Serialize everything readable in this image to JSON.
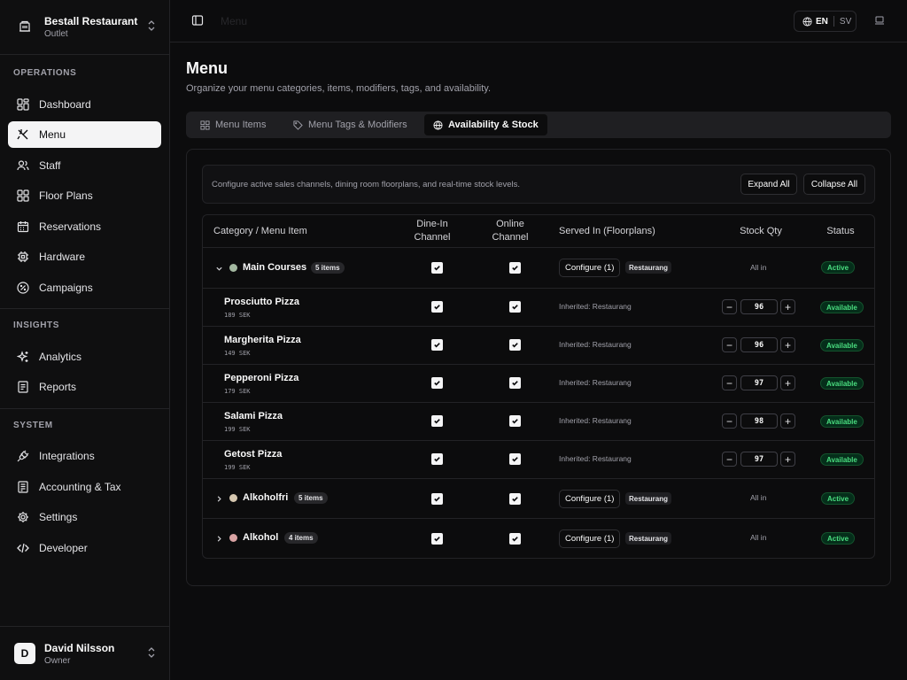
{
  "org": {
    "name": "Bestall Restaurant",
    "sub": "Outlet"
  },
  "sidebar": {
    "sections": [
      {
        "label": "OPERATIONS"
      },
      {
        "label": "INSIGHTS"
      },
      {
        "label": "SYSTEM"
      }
    ],
    "items": [
      {
        "label": "Dashboard",
        "icon": "dashboard-icon"
      },
      {
        "label": "Menu",
        "icon": "utensils-icon",
        "active": true
      },
      {
        "label": "Staff",
        "icon": "users-icon"
      },
      {
        "label": "Floor Plans",
        "icon": "floor-plan-icon"
      },
      {
        "label": "Reservations",
        "icon": "calendar-icon"
      },
      {
        "label": "Hardware",
        "icon": "chip-icon"
      },
      {
        "label": "Campaigns",
        "icon": "campaign-icon"
      },
      {
        "label": "Analytics",
        "icon": "sparkles-icon"
      },
      {
        "label": "Reports",
        "icon": "report-icon"
      },
      {
        "label": "Integrations",
        "icon": "plug-icon"
      },
      {
        "label": "Accounting & Tax",
        "icon": "receipt-icon"
      },
      {
        "label": "Settings",
        "icon": "gear-icon"
      },
      {
        "label": "Developer",
        "icon": "code-icon"
      }
    ]
  },
  "user": {
    "initial": "D",
    "name": "David Nilsson",
    "role": "Owner"
  },
  "topbar": {
    "breadcrumb": "Menu",
    "lang_active": "EN",
    "lang_other": "SV"
  },
  "page": {
    "title": "Menu",
    "subtitle": "Organize your menu categories, items, modifiers, tags, and availability."
  },
  "tabs": [
    {
      "label": "Menu Items",
      "icon": "grid-icon"
    },
    {
      "label": "Menu Tags & Modifiers",
      "icon": "tag-icon"
    },
    {
      "label": "Availability & Stock",
      "icon": "globe-icon",
      "active": true
    }
  ],
  "notice": {
    "text": "Configure active sales channels, dining room floorplans, and real-time stock levels.",
    "expand_all": "Expand All",
    "collapse_all": "Collapse All"
  },
  "table": {
    "headers": {
      "category": "Category / Menu Item",
      "dine_in": "Dine-In Channel",
      "online": "Online Channel",
      "served_in": "Served In (Floorplans)",
      "stock": "Stock Qty",
      "status": "Status"
    },
    "categories": [
      {
        "name": "Main Courses",
        "count": "5 items",
        "dot_color": "#a3b8a0",
        "configure": "Configure (1)",
        "tag": "Restaurang",
        "stock": "All in",
        "status": "Active",
        "expanded": true,
        "items": [
          {
            "name": "Prosciutto Pizza",
            "price": "189 SEK",
            "served": "Inherited: Restaurang",
            "qty": "96",
            "status": "Available"
          },
          {
            "name": "Margherita Pizza",
            "price": "149 SEK",
            "served": "Inherited: Restaurang",
            "qty": "96",
            "status": "Available"
          },
          {
            "name": "Pepperoni Pizza",
            "price": "179 SEK",
            "served": "Inherited: Restaurang",
            "qty": "97",
            "status": "Available"
          },
          {
            "name": "Salami Pizza",
            "price": "199 SEK",
            "served": "Inherited: Restaurang",
            "qty": "98",
            "status": "Available"
          },
          {
            "name": "Getost Pizza",
            "price": "199 SEK",
            "served": "Inherited: Restaurang",
            "qty": "97",
            "status": "Available"
          }
        ]
      },
      {
        "name": "Alkoholfri",
        "count": "5 items",
        "dot_color": "#d6c7b0",
        "configure": "Configure (1)",
        "tag": "Restaurang",
        "stock": "All in",
        "status": "Active"
      },
      {
        "name": "Alkohol",
        "count": "4 items",
        "dot_color": "#d9a3a3",
        "configure": "Configure (1)",
        "tag": "Restaurang",
        "stock": "All in",
        "status": "Active"
      }
    ]
  }
}
